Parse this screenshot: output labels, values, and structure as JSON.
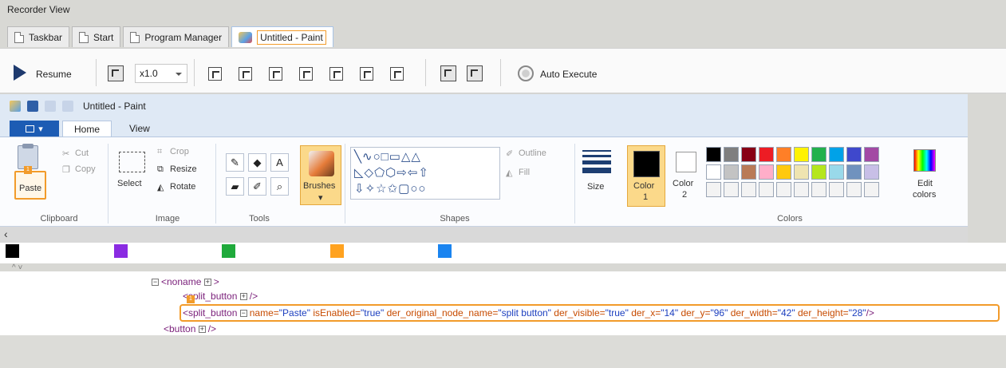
{
  "window_title": "Recorder View",
  "tabs": [
    {
      "label": "Taskbar"
    },
    {
      "label": "Start"
    },
    {
      "label": "Program Manager"
    },
    {
      "label": "Untitled - Paint",
      "active": true
    }
  ],
  "toolbar": {
    "resume_label": "Resume",
    "zoom_value": "x1.0",
    "auto_execute_label": "Auto Execute"
  },
  "paint": {
    "title": "Untitled - Paint",
    "ribbon_tabs": [
      "Home",
      "View"
    ],
    "clipboard": {
      "cut": "Cut",
      "copy": "Copy",
      "paste": "Paste",
      "label": "Clipboard"
    },
    "image": {
      "crop": "Crop",
      "resize": "Resize",
      "rotate": "Rotate",
      "select": "Select",
      "label": "Image"
    },
    "tools": {
      "label": "Tools",
      "text_tool": "A"
    },
    "brushes": {
      "label": "Brushes"
    },
    "shapes": {
      "outline": "Outline",
      "fill": "Fill",
      "label": "Shapes"
    },
    "size": {
      "label": "Size"
    },
    "colors": {
      "color1": "Color",
      "color1_num": "1",
      "color2": "Color",
      "color2_num": "2",
      "edit": "Edit",
      "edit2": "colors",
      "label": "Colors"
    },
    "palette_row1": [
      "#000000",
      "#7f7f7f",
      "#880015",
      "#ed1c24",
      "#ff7f27",
      "#fff200",
      "#22b14c",
      "#00a2e8",
      "#3f48cc",
      "#a349a4"
    ],
    "palette_row2": [
      "#ffffff",
      "#c3c3c3",
      "#b97a57",
      "#ffaec9",
      "#ffc90e",
      "#efe4b0",
      "#b5e61d",
      "#99d9ea",
      "#7092be",
      "#c8bfe7"
    ]
  },
  "color_chips": [
    "#000000",
    "#8a2be2",
    "#1faa3b",
    "#ffa21f",
    "#1a84f0"
  ],
  "tree": {
    "root": "<noname",
    "root_close": ">",
    "child1": "<split_button",
    "child1_close": "/>",
    "selected_tag": "<split_button",
    "sel_attr1": "name=",
    "sel_val1": "\"Paste\"",
    "sel_attr2": "isEnabled=",
    "sel_val2": "\"true\"",
    "sel_attr3": "der_original_node_name=",
    "sel_val3": "\"split button\"",
    "sel_attr4": "der_visible=",
    "sel_val4": "\"true\"",
    "sel_attr5": "der_x=",
    "sel_val5": "\"14\"",
    "sel_attr6": "der_y=",
    "sel_val6": "\"96\"",
    "sel_attr7": "der_width=",
    "sel_val7": "\"42\"",
    "sel_attr8": "der_height=",
    "sel_val8": "\"28\"",
    "sel_close": "/>",
    "child3": "<button",
    "child3_close": "/>",
    "badge": "1"
  },
  "badge": "1"
}
